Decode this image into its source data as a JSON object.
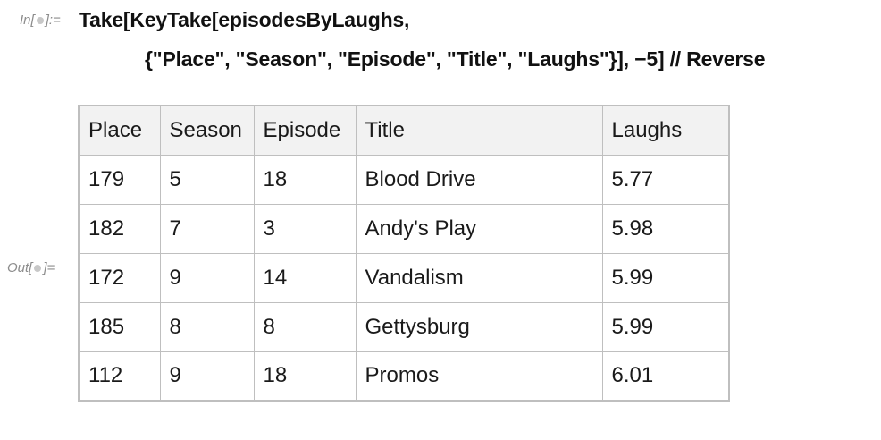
{
  "input_label": "In[",
  "input_label_end": "]:=",
  "output_label": "Out[",
  "output_label_end": "]=",
  "code": {
    "line1": "Take[KeyTake[episodesByLaughs,",
    "line2": "{\"Place\", \"Season\", \"Episode\", \"Title\", \"Laughs\"}], −5] // Reverse"
  },
  "table": {
    "headers": [
      "Place",
      "Season",
      "Episode",
      "Title",
      "Laughs"
    ],
    "rows": [
      [
        "179",
        "5",
        "18",
        "Blood Drive",
        "5.77"
      ],
      [
        "182",
        "7",
        "3",
        "Andy's Play",
        "5.98"
      ],
      [
        "172",
        "9",
        "14",
        "Vandalism",
        "5.99"
      ],
      [
        "185",
        "8",
        "8",
        "Gettysburg",
        "5.99"
      ],
      [
        "112",
        "9",
        "18",
        "Promos",
        "6.01"
      ]
    ]
  }
}
